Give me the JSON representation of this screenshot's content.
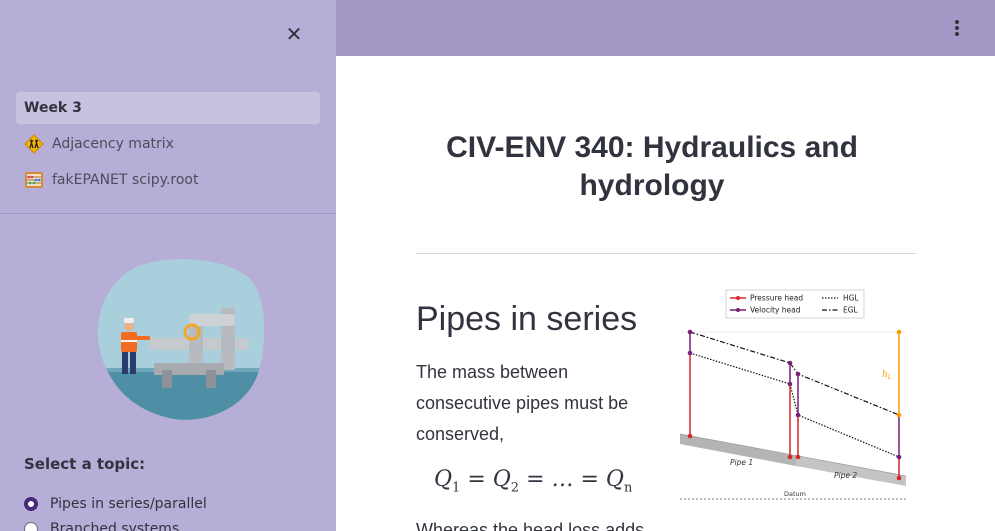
{
  "sidebar": {
    "nav_items": [
      {
        "label": "Week 3",
        "active": true
      },
      {
        "label": "Adjacency matrix",
        "icon": "construction-workers-icon"
      },
      {
        "label": "fakEPANET scipy.root",
        "icon": "abacus-icon"
      }
    ],
    "hero_icon": "pipe-worker-illustration",
    "topic_label": "Select a topic:",
    "topics": [
      {
        "label": "Pipes in series/parallel",
        "selected": true
      },
      {
        "label": "Branched systems",
        "selected": false
      }
    ]
  },
  "main": {
    "page_title": "CIV-ENV 340: Hydraulics and hydrology",
    "section_heading": "Pipes in series",
    "body": "The mass between consecutive pipes must be conserved,",
    "equation": {
      "lhs": "Q",
      "s1": "1",
      "s2": "2",
      "dots": "…",
      "sn": "n"
    },
    "body_continued": "Whereas the head loss adds"
  },
  "diagram": {
    "legend": {
      "pressure_head": "Pressure head",
      "velocity_head": "Velocity head",
      "hgl": "HGL",
      "egl": "EGL"
    },
    "labels": {
      "h": "h",
      "h_sub": "L",
      "pipe1": "Pipe 1",
      "pipe2": "Pipe 2",
      "datum": "Datum"
    }
  },
  "colors": {
    "sidebar_bg": "#b6aed6",
    "topbar_bg": "#a497c6",
    "pressure": "#d62728",
    "velocity": "#7b1f7b",
    "headloss": "#ff9900",
    "radio_selected": "#4a2a77"
  }
}
